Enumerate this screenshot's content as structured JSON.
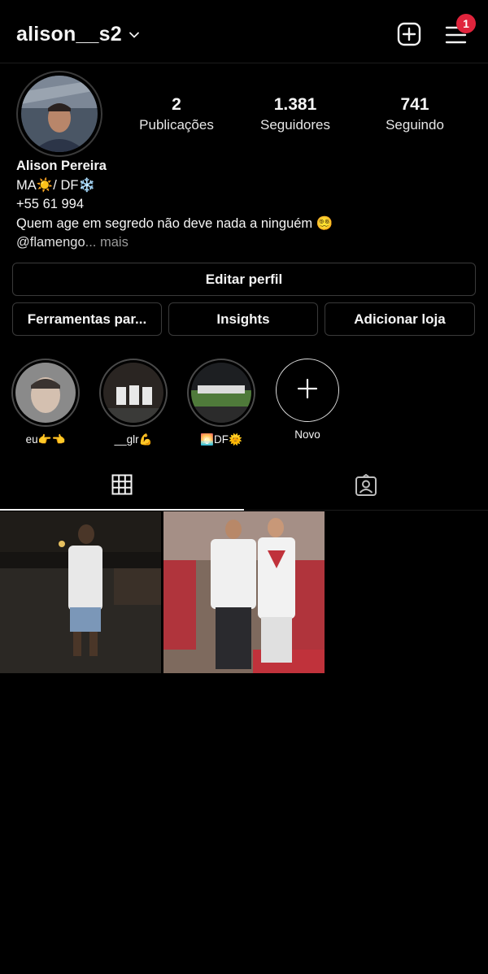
{
  "header": {
    "username": "alison__s2",
    "notification_count": "1",
    "icons": [
      "chevron-down-icon",
      "add-post-icon",
      "menu-icon"
    ]
  },
  "profile": {
    "stats": [
      {
        "value": "2",
        "label": "Publicações"
      },
      {
        "value": "1.381",
        "label": "Seguidores"
      },
      {
        "value": "741",
        "label": "Seguindo"
      }
    ],
    "bio": {
      "name": "Alison Pereira",
      "line1": "MA☀️/ DF❄️",
      "phone": "+55 61 994",
      "line3": "Quem age em segredo não deve nada a ninguém 😵‍💫",
      "link": "@flamengo",
      "more": "... mais"
    }
  },
  "buttons": {
    "edit_profile": "Editar perfil",
    "tools": "Ferramentas par...",
    "insights": "Insights",
    "add_shop": "Adicionar loja"
  },
  "highlights": [
    {
      "label": "eu👉👈"
    },
    {
      "label": "__glr💪"
    },
    {
      "label": "🌅DF🌞"
    },
    {
      "label": "Novo"
    }
  ],
  "tabs": [
    "grid-icon",
    "tagged-icon"
  ],
  "colors": {
    "background": "#000000",
    "badge": "#e0243c",
    "border": "#3a3a3a"
  }
}
